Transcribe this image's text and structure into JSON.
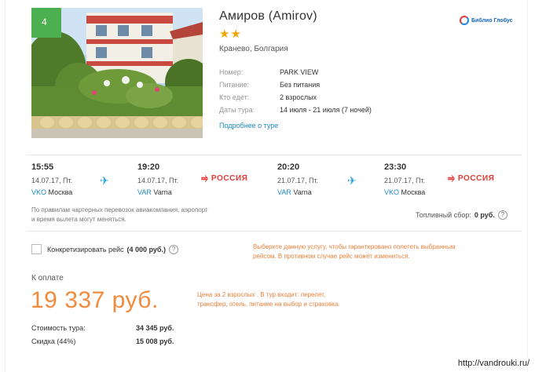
{
  "hotel": {
    "rank": "4",
    "name": "Амиров (Amirov)",
    "stars": "★★",
    "location": "Кранево, Болгария",
    "brand": "Библио Глобус",
    "details": [
      {
        "label": "Номер:",
        "value": "PARK VIEW"
      },
      {
        "label": "Питание:",
        "value": "Без питания"
      },
      {
        "label": "Кто едет:",
        "value": "2 взрослых"
      },
      {
        "label": "Даты тура:",
        "value": "14 июля - 21 июля (7 ночей)"
      }
    ],
    "more_link": "Подробнее о туре"
  },
  "flights": {
    "outbound": {
      "dep_time": "15:55",
      "dep_date": "14.07.17, Пт.",
      "dep_code": "VKO",
      "dep_city": "Москва",
      "arr_time": "19:20",
      "arr_date": "14.07.17, Пт.",
      "arr_code": "VAR",
      "arr_city": "Varna",
      "airline": "РОССИЯ"
    },
    "return": {
      "dep_time": "20:20",
      "dep_date": "21.07.17, Пт.",
      "dep_code": "VAR",
      "dep_city": "Varna",
      "arr_time": "23:30",
      "arr_date": "21.07.17, Пт.",
      "arr_code": "VKO",
      "arr_city": "Москва",
      "airline": "РОССИЯ"
    },
    "plane_icon": "plane-icon",
    "charter_note": "По правилам чартерных перевозок авиакомпания, аэропорт и время вылета могут меняться.",
    "fuel_label": "Топливный сбор:",
    "fuel_value": "0 руб."
  },
  "options": {
    "specify_flight_label": "Конкретизировать рейс",
    "specify_flight_price": "(4 000 руб.)",
    "specify_flight_note": "Выберите данную услугу, чтобы гарантировано полететь выбранным рейсом. В противном случае рейс может измениться."
  },
  "payment": {
    "label": "К оплате",
    "total": "19 337 руб.",
    "note": "Цена за 2 взрослых . В тур входит: перелет, трансфер, отель, питание на выбор и страховка.",
    "cost_label": "Стоимость тура:",
    "cost_value": "34 345 руб.",
    "discount_label": "Скидка (44%)",
    "discount_value": "15 008 руб."
  },
  "watermark": "http://vandrouki.ru/",
  "colors": {
    "accent_orange": "#f08a3c",
    "link_blue": "#1e88c8",
    "rank_green": "#4caf50",
    "airline_red": "#e53935"
  }
}
